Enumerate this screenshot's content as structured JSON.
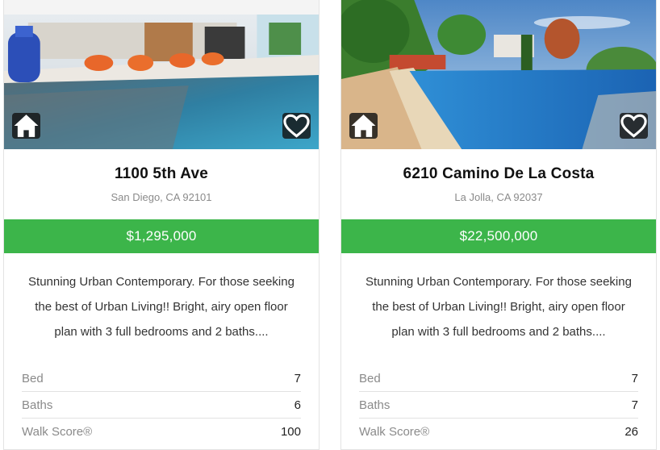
{
  "listings": [
    {
      "address": "1100 5th Ave",
      "city": "San Diego, CA 92101",
      "price": "$1,295,000",
      "description": "Stunning Urban Contemporary. For those seeking the best of Urban Living!! Bright, airy open floor plan with 3 full bedrooms and 2 baths....",
      "specs": [
        {
          "label": "Bed",
          "value": "7"
        },
        {
          "label": "Baths",
          "value": "6"
        },
        {
          "label": "Walk Score®",
          "value": "100"
        }
      ]
    },
    {
      "address": "6210 Camino De La Costa",
      "city": "La Jolla, CA 92037",
      "price": "$22,500,000",
      "description": "Stunning Urban Contemporary. For those seeking the best of Urban Living!! Bright, airy open floor plan with 3 full bedrooms and 2 baths....",
      "specs": [
        {
          "label": "Bed",
          "value": "7"
        },
        {
          "label": "Baths",
          "value": "7"
        },
        {
          "label": "Walk Score®",
          "value": "26"
        }
      ]
    }
  ],
  "icons": {
    "home": "home-icon",
    "favorite": "heart-icon"
  },
  "colors": {
    "price_bar": "#3cb54a",
    "icon_button_bg": "#1e1e1e"
  }
}
